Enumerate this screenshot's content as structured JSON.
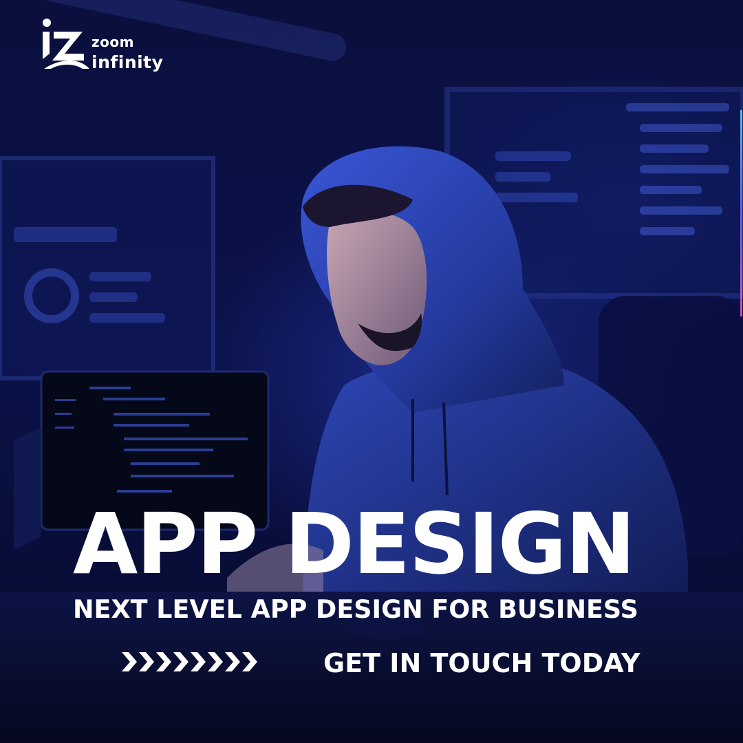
{
  "brand": {
    "name_line1": "zoom",
    "name_line2": "infinity",
    "icon": "zoom-infinity-logo-icon"
  },
  "hero": {
    "headline": "APP DESIGN",
    "subheadline": "NEXT LEVEL APP DESIGN FOR BUSINESS"
  },
  "cta": {
    "arrows_icon": "chevron-arrows-icon",
    "label": "GET IN TOUCH TODAY"
  },
  "theme": {
    "background": "#0a0f3d",
    "accent_blue": "#2f48c9",
    "text": "#ffffff"
  }
}
